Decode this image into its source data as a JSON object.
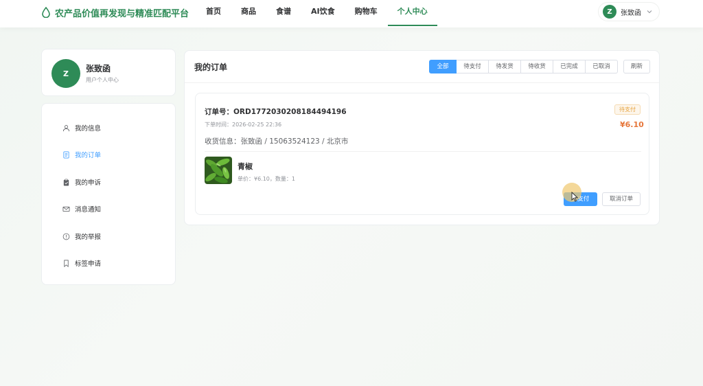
{
  "header": {
    "brand_title": "农产品价值再发现与精准匹配平台",
    "nav": [
      {
        "label": "首页"
      },
      {
        "label": "商品"
      },
      {
        "label": "食谱"
      },
      {
        "label": "AI饮食"
      },
      {
        "label": "购物车"
      },
      {
        "label": "个人中心"
      }
    ],
    "active_nav": "个人中心",
    "user": {
      "avatar_letter": "Z",
      "name": "张致函"
    }
  },
  "profile": {
    "avatar_letter": "Z",
    "name": "张致函",
    "subtitle": "用户个人中心"
  },
  "sidebar": {
    "items": [
      {
        "label": "我的信息",
        "icon": "user-icon"
      },
      {
        "label": "我的订单",
        "icon": "document-icon"
      },
      {
        "label": "我的申诉",
        "icon": "clipboard-icon"
      },
      {
        "label": "消息通知",
        "icon": "mail-icon"
      },
      {
        "label": "我的举报",
        "icon": "info-circle-icon"
      },
      {
        "label": "标签申请",
        "icon": "bookmark-icon"
      }
    ],
    "active_item": "我的订单"
  },
  "orders": {
    "title": "我的订单",
    "filters": [
      {
        "label": "全部"
      },
      {
        "label": "待支付"
      },
      {
        "label": "待发货"
      },
      {
        "label": "待收货"
      },
      {
        "label": "已完成"
      },
      {
        "label": "已取消"
      }
    ],
    "active_filter": "全部",
    "refresh_label": "刷新",
    "list": [
      {
        "order_no": "订单号：ORD1772030208184494196",
        "time": "下单时间：2026-02-25 22:36",
        "status": "待支付",
        "amount": "¥6.10",
        "shipping": "收货信息：张致函 / 15063524123 / 北京市",
        "product_name": "青椒",
        "product_meta": "单价：¥6.10，数量：1",
        "pay_label": "去支付",
        "cancel_label": "取消订单"
      }
    ]
  },
  "colors": {
    "brand": "#2e8b57",
    "primary": "#409eff",
    "warning": "#e6a23c",
    "price": "#e6763a"
  }
}
